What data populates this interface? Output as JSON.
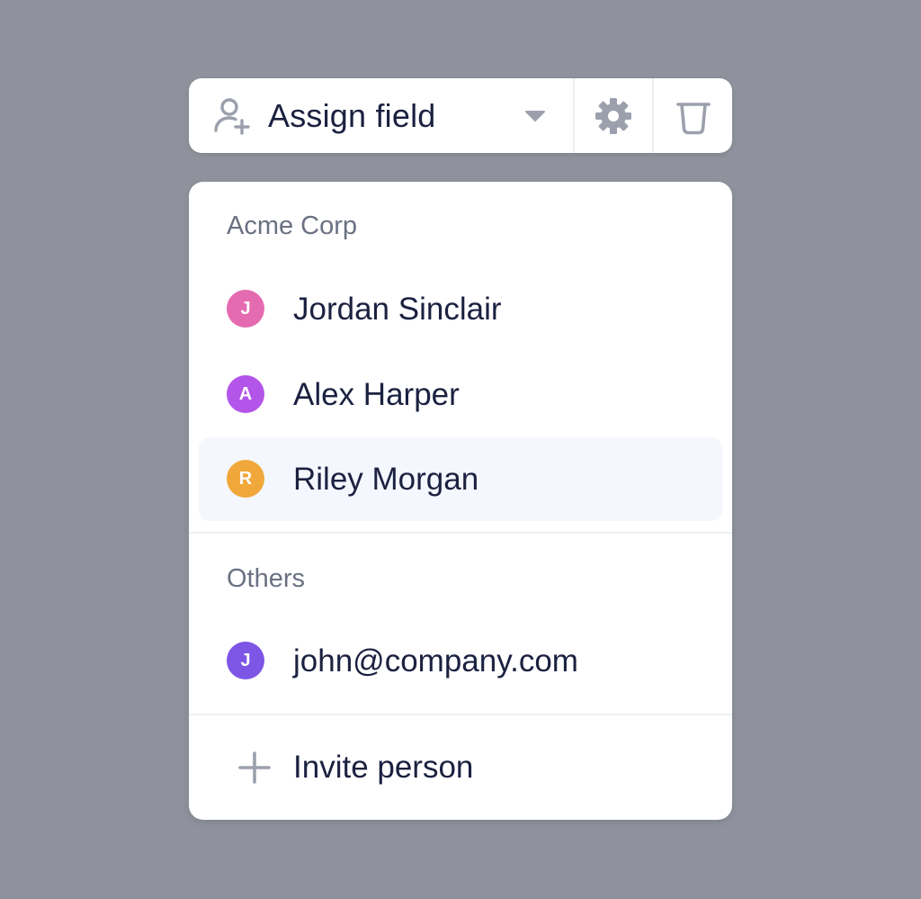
{
  "toolbar": {
    "assign_label": "Assign field",
    "icons": [
      "user-plus-icon",
      "caret-down-icon",
      "gear-icon",
      "trash-icon"
    ]
  },
  "menu": {
    "sections": [
      {
        "title": "Acme Corp",
        "items": [
          {
            "initial": "J",
            "name": "Jordan Sinclair",
            "color": "#e46bb0"
          },
          {
            "initial": "A",
            "name": "Alex Harper",
            "color": "#b355e8"
          },
          {
            "initial": "R",
            "name": "Riley Morgan",
            "color": "#f0a83a",
            "highlighted": true
          }
        ]
      },
      {
        "title": "Others",
        "items": [
          {
            "initial": "J",
            "name": "john@company.com",
            "color": "#7d56e6"
          }
        ]
      }
    ],
    "invite_label": "Invite person"
  },
  "colors": {
    "background": "#8f919c",
    "text": "#1b2140",
    "muted_text": "#6b7183",
    "icon_gray": "#9ca0ad",
    "highlight": "#f4f7fd"
  }
}
